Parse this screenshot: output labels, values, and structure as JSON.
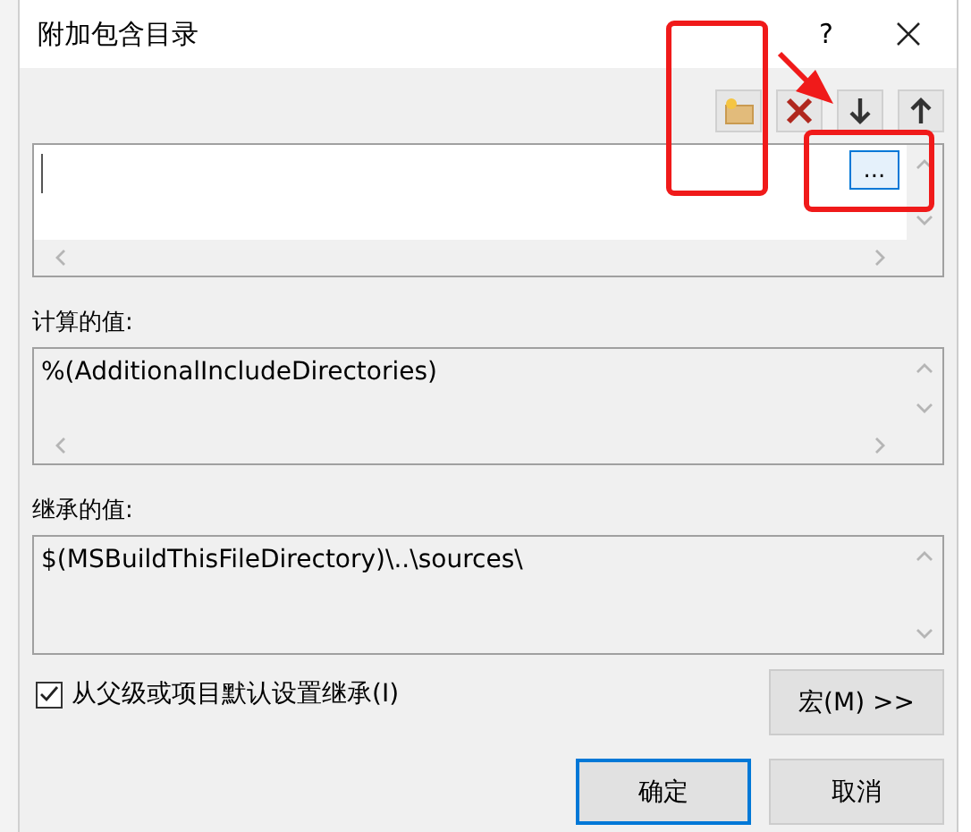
{
  "window": {
    "title": "附加包含目录",
    "help": "?"
  },
  "editor": {
    "browse_button": "..."
  },
  "computed": {
    "label": "计算的值:",
    "value": "%(AdditionalIncludeDirectories)"
  },
  "inherited": {
    "label": "继承的值:",
    "value": "$(MSBuildThisFileDirectory)\\..\\sources\\"
  },
  "inherit_checkbox": {
    "label": "从父级或项目默认设置继承(I)",
    "checked": true
  },
  "macros_button": "宏(M) >>",
  "buttons": [
    {
      "label": "确定",
      "default": true
    },
    {
      "label": "取消",
      "default": false
    }
  ]
}
